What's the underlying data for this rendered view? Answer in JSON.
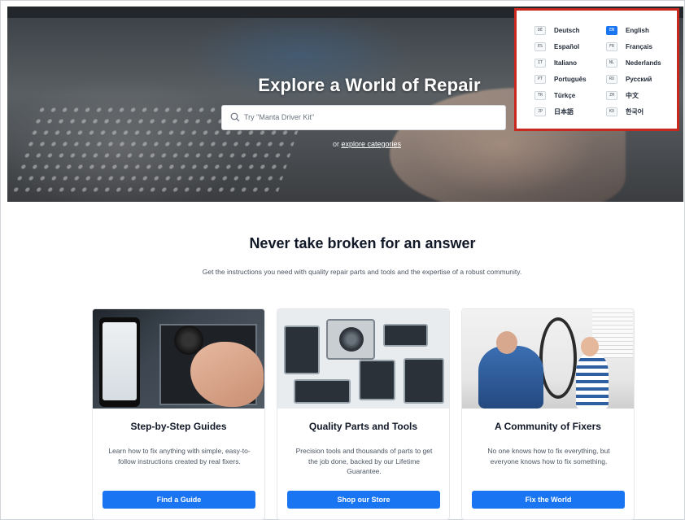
{
  "hero": {
    "title": "Explore a World of Repair",
    "search_placeholder": "Try \"Manta Driver Kit\"",
    "explore_prefix": "or",
    "explore_link": "explore categories"
  },
  "languages": [
    {
      "code": "DE",
      "name": "Deutsch",
      "active": false
    },
    {
      "code": "EN",
      "name": "English",
      "active": true
    },
    {
      "code": "ES",
      "name": "Español",
      "active": false
    },
    {
      "code": "FR",
      "name": "Français",
      "active": false
    },
    {
      "code": "IT",
      "name": "Italiano",
      "active": false
    },
    {
      "code": "NL",
      "name": "Nederlands",
      "active": false
    },
    {
      "code": "PT",
      "name": "Português",
      "active": false
    },
    {
      "code": "RU",
      "name": "Русский",
      "active": false
    },
    {
      "code": "TR",
      "name": "Türkçe",
      "active": false
    },
    {
      "code": "ZH",
      "name": "中文",
      "active": false
    },
    {
      "code": "JP",
      "name": "日本語",
      "active": false
    },
    {
      "code": "KO",
      "name": "한국어",
      "active": false
    }
  ],
  "section": {
    "headline": "Never take broken for an answer",
    "subhead": "Get the instructions you need with quality repair parts and tools and the expertise of a robust community."
  },
  "cards": [
    {
      "title": "Step-by-Step Guides",
      "desc": "Learn how to fix anything with simple, easy-to-follow instructions created by real fixers.",
      "button": "Find a Guide"
    },
    {
      "title": "Quality Parts and Tools",
      "desc": "Precision tools and thousands of parts to get the job done, backed by our Lifetime Guarantee.",
      "button": "Shop our Store"
    },
    {
      "title": "A Community of Fixers",
      "desc": "No one knows how to fix everything, but everyone knows how to fix something.",
      "button": "Fix the World"
    }
  ],
  "colors": {
    "accent": "#1975f2",
    "highlight_border": "#c8281e"
  }
}
